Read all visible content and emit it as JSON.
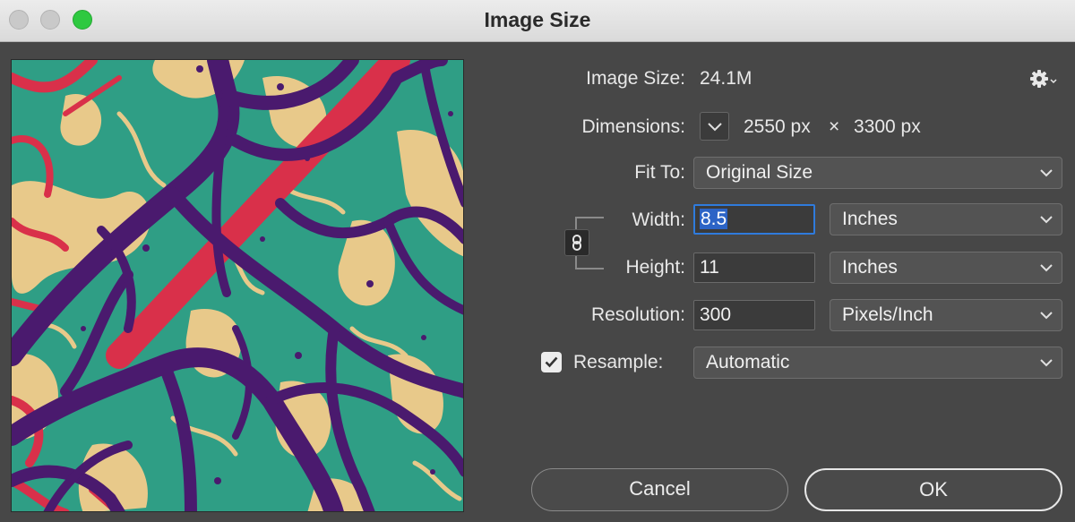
{
  "window": {
    "title": "Image Size"
  },
  "image_size": {
    "label": "Image Size:",
    "value": "24.1M"
  },
  "dimensions": {
    "label": "Dimensions:",
    "width": "2550 px",
    "times": "×",
    "height": "3300 px"
  },
  "fit_to": {
    "label": "Fit To:",
    "value": "Original Size"
  },
  "width": {
    "label": "Width:",
    "value": "8.5",
    "unit": "Inches"
  },
  "height": {
    "label": "Height:",
    "value": "11",
    "unit": "Inches"
  },
  "resolution": {
    "label": "Resolution:",
    "value": "300",
    "unit": "Pixels/Inch"
  },
  "resample": {
    "label": "Resample:",
    "checked": true,
    "value": "Automatic"
  },
  "buttons": {
    "cancel": "Cancel",
    "ok": "OK"
  },
  "icons": {
    "settings": "gear-icon",
    "link": "chain-link-icon",
    "toggle": "chevron-down-icon"
  },
  "colors": {
    "accent": "#2f7bdc",
    "close_light": "#c9c9c9",
    "zoom_light": "#2ec940",
    "dialog_bg": "#474747"
  }
}
